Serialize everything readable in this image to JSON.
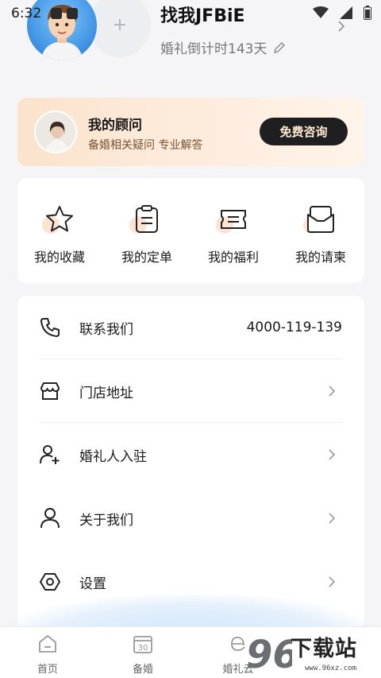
{
  "status_bar": {
    "time": "6:32",
    "icons": [
      "notification-icon",
      "notification-a-icon",
      "wifi-icon",
      "signal-icon",
      "battery-icon"
    ]
  },
  "profile": {
    "username": "找我JFBiE",
    "countdown": "婚礼倒计时143天",
    "add_symbol": "+"
  },
  "advisor": {
    "title": "我的顾问",
    "subtitle": "备婚相关疑问 专业解答",
    "button_label": "免费咨询"
  },
  "quick_actions": [
    {
      "label": "我的收藏",
      "icon": "star-icon"
    },
    {
      "label": "我的定单",
      "icon": "clipboard-icon"
    },
    {
      "label": "我的福利",
      "icon": "ticket-icon"
    },
    {
      "label": "我的请柬",
      "icon": "envelope-icon"
    }
  ],
  "menu": {
    "items": [
      {
        "label": "联系我们",
        "value": "4000-119-139",
        "icon": "phone-icon"
      },
      {
        "label": "门店地址",
        "value": "",
        "icon": "store-icon"
      },
      {
        "label": "婚礼人入驻",
        "value": "",
        "icon": "add-user-icon"
      },
      {
        "label": "关于我们",
        "value": "",
        "icon": "user-icon"
      },
      {
        "label": "设置",
        "value": "",
        "icon": "settings-icon"
      }
    ]
  },
  "bottom_nav": {
    "items": [
      {
        "label": "首页",
        "icon": "home-icon"
      },
      {
        "label": "备婚",
        "icon": "calendar-icon"
      },
      {
        "label": "婚礼云",
        "icon": "cloud-icon"
      }
    ]
  },
  "watermark": {
    "number": "96",
    "text": "下载站",
    "url": "www.96xz.com"
  },
  "colors": {
    "accent_dark": "#1f1f22",
    "advisor_gradient_start": "#fbe3cc",
    "icon_blob": "#fde3d3",
    "background": "#f5f5f7"
  }
}
